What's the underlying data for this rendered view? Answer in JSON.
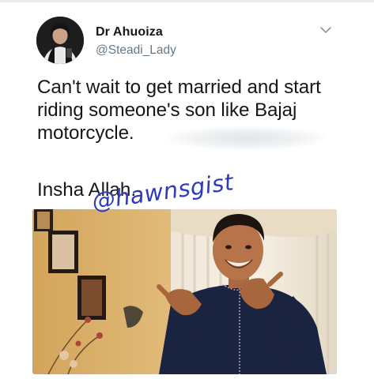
{
  "tweet": {
    "display_name": "Dr Ahuoiza",
    "handle": "@Steadi_Lady",
    "text": "Can't wait to get married and start\nriding someone's son like Bajaj\nmotorcycle.",
    "text_line2": "Insha Allah.",
    "menu_icon": "chevron-down-icon"
  },
  "media": {
    "watermark": "@hawnsgist"
  },
  "colors": {
    "text": "#14171a",
    "handle": "#657786",
    "watermark": "#2e3ab8"
  }
}
